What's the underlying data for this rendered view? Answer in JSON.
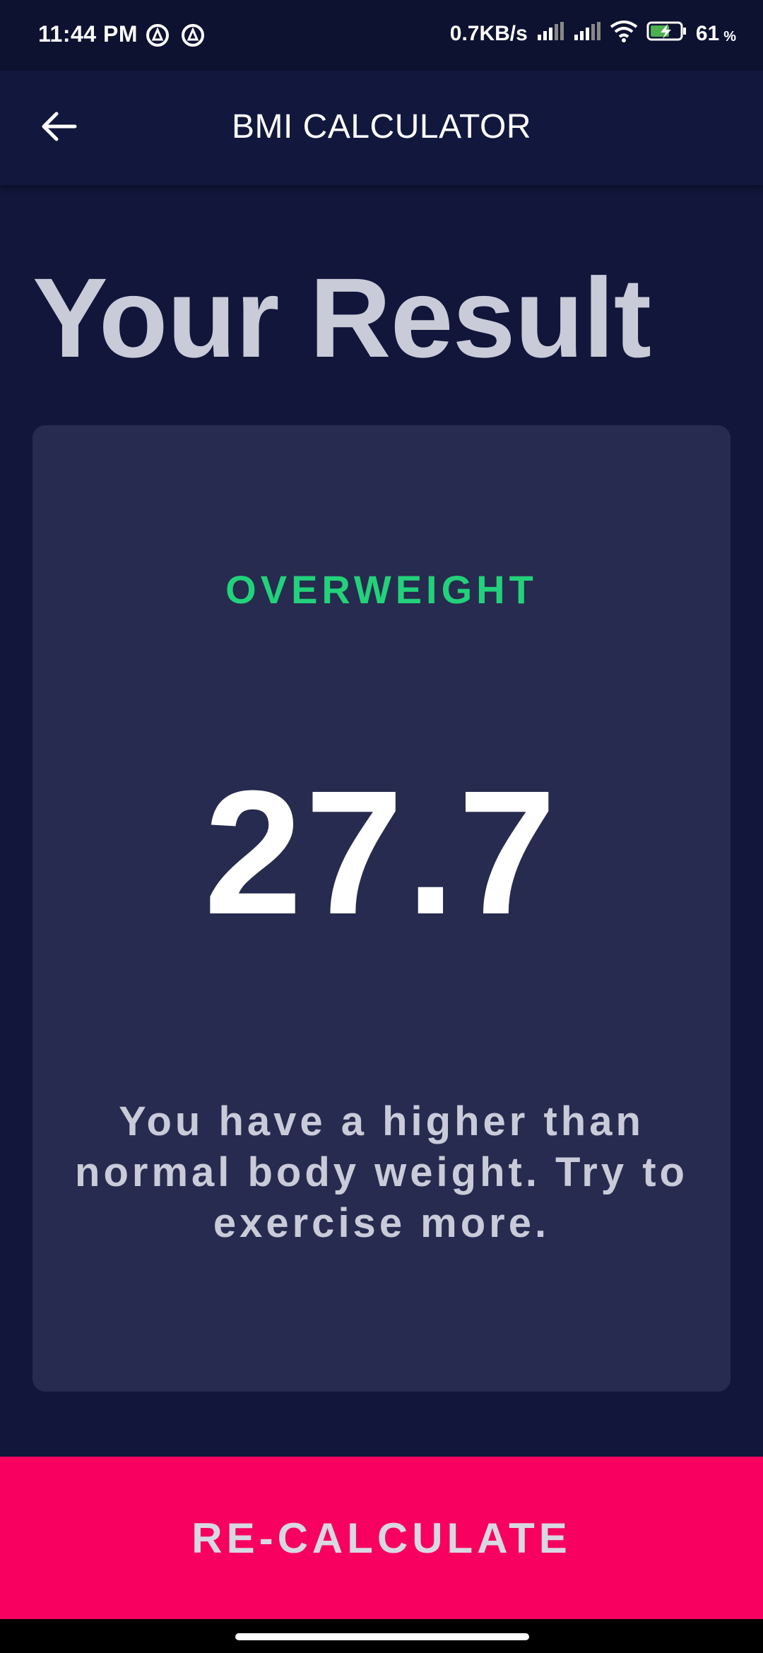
{
  "status_bar": {
    "time": "11:44 PM",
    "network_speed": "0.7KB/s",
    "battery_level": "61",
    "battery_unit": "%",
    "icons": [
      "app-notification-icon",
      "app-notification-icon",
      "signal-icon",
      "signal-icon",
      "wifi-icon",
      "battery-charging-icon"
    ]
  },
  "app_bar": {
    "title": "BMI CALCULATOR",
    "back_icon": "arrow-back-icon"
  },
  "page": {
    "heading": "Your Result"
  },
  "result": {
    "status": "OVERWEIGHT",
    "bmi": "27.7",
    "advice": "You have a higher than normal body weight. Try to exercise more."
  },
  "actions": {
    "recalculate_label": "RE-CALCULATE"
  },
  "colors": {
    "background": "#11163a",
    "app_bar": "#12173d",
    "card": "#272b4f",
    "status_green": "#22d27a",
    "accent_pink": "#f7005f",
    "text_muted": "#c9cbd9"
  }
}
